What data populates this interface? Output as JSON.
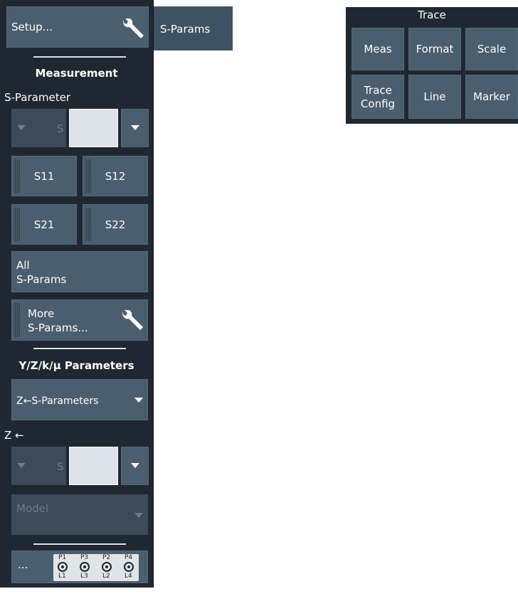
{
  "panel": {
    "setup_label": "Setup...",
    "measurement_header": "Measurement",
    "sparam_label": "S-Parameter",
    "s_prefix": "S",
    "buttons": [
      "S11",
      "S12",
      "S21",
      "S22"
    ],
    "all_sparams_line1": "All",
    "all_sparams_line2": "S-Params",
    "more_line1": "More",
    "more_line2": "S-Params...",
    "yzk_header": "Y/Z/k/µ Parameters",
    "convert_select": "Z←S-Parameters",
    "z_label": "Z ←",
    "z_s_prefix": "S",
    "model_label": "Model",
    "ellipsis_label": "...",
    "ports_top": [
      "P1",
      "P3",
      "P2",
      "P4"
    ],
    "ports_bottom": [
      "L1",
      "L3",
      "L2",
      "L4"
    ]
  },
  "tab": {
    "label": "S-Params"
  },
  "trace": {
    "title": "Trace",
    "buttons": [
      {
        "line1": "Meas",
        "line2": ""
      },
      {
        "line1": "Format",
        "line2": ""
      },
      {
        "line1": "Scale",
        "line2": ""
      },
      {
        "line1": "Trace",
        "line2": "Config"
      },
      {
        "line1": "Line",
        "line2": ""
      },
      {
        "line1": "Marker",
        "line2": ""
      }
    ]
  },
  "colors": {
    "panel_bg": "#1f2830",
    "button_bg": "#4a5e6d",
    "button_disabled_bg": "#3c4b57",
    "text": "#ffffff",
    "input_bg": "#dde3e8"
  },
  "icons": [
    "wrench-icon",
    "dropdown-arrow-icon",
    "port-connector-icon"
  ]
}
